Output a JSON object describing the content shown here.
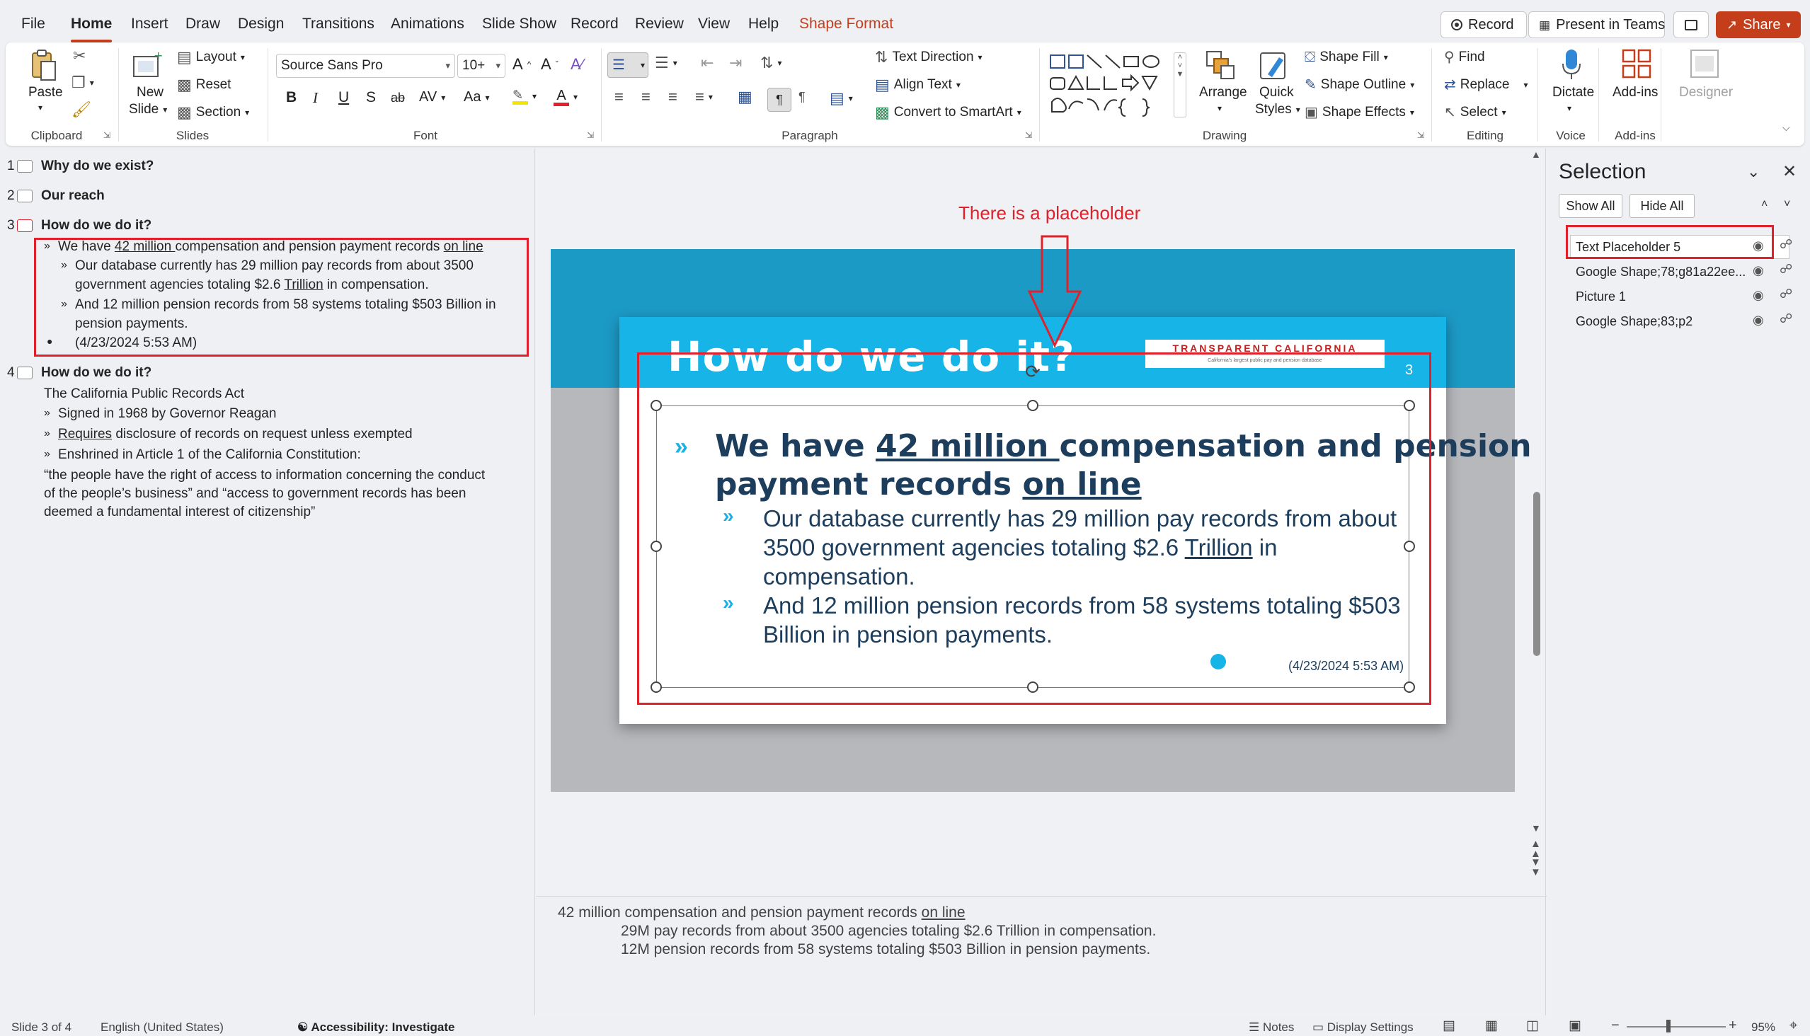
{
  "menu": {
    "items": [
      "File",
      "Home",
      "Insert",
      "Draw",
      "Design",
      "Transitions",
      "Animations",
      "Slide Show",
      "Record",
      "Review",
      "View",
      "Help",
      "Shape Format"
    ],
    "active": "Home",
    "record": "Record",
    "present_teams": "Present in Teams",
    "share": "Share"
  },
  "ribbon": {
    "clipboard": {
      "paste": "Paste",
      "label": "Clipboard"
    },
    "slides": {
      "new_slide_1": "New",
      "new_slide_2": "Slide",
      "layout": "Layout",
      "reset": "Reset",
      "section": "Section",
      "label": "Slides"
    },
    "font": {
      "family": "Source Sans Pro",
      "size": "10+",
      "label": "Font",
      "bold": "B",
      "italic": "I",
      "underline": "U",
      "strike": "S",
      "abc": "ab",
      "spacing": "AV",
      "case": "Aa",
      "grow": "A^",
      "shrink": "A˅"
    },
    "paragraph": {
      "text_direction": "Text Direction",
      "align_text": "Align Text",
      "convert_smartart": "Convert to SmartArt",
      "label": "Paragraph"
    },
    "drawing": {
      "arrange": "Arrange",
      "quick_styles_1": "Quick",
      "quick_styles_2": "Styles",
      "shape_fill": "Shape Fill",
      "shape_outline": "Shape Outline",
      "shape_effects": "Shape Effects",
      "label": "Drawing"
    },
    "editing": {
      "find": "Find",
      "replace": "Replace",
      "select": "Select",
      "label": "Editing"
    },
    "voice": {
      "dictate": "Dictate",
      "label": "Voice"
    },
    "addins": {
      "addins": "Add-ins",
      "label": "Add-ins"
    },
    "designer": {
      "designer": "Designer"
    }
  },
  "outline": {
    "slides": [
      {
        "num": "1",
        "title": "Why do we exist?"
      },
      {
        "num": "2",
        "title": "Our reach"
      },
      {
        "num": "3",
        "title": "How do we do it?"
      },
      {
        "num": "4",
        "title": "How do we do it?"
      }
    ],
    "slide3": {
      "l1_a": "We have ",
      "l1_b": "42 million ",
      "l1_c": "compensation and pension payment records ",
      "l1_d": "on line",
      "l2_a1": "Our database currently has 29 million pay records from about 3500",
      "l2_a2a": "government agencies totaling $2.6 ",
      "l2_a2b": "Trillion",
      "l2_a2c": " in compensation.",
      "l2_b1": "And 12 million pension records from 58 systems totaling $503 Billion in",
      "l2_b2": "pension payments.",
      "date": "(4/23/2024 5:53 AM)"
    },
    "slide4": {
      "intro": "The California Public Records Act",
      "b1": "Signed in 1968 by Governor Reagan",
      "b2a": "Requires",
      "b2b": " disclosure of records on request unless exempted",
      "b3": "Enshrined in Article 1 of the California Constitution:",
      "q1": "“the people have the right of access to information concerning the conduct",
      "q2": "of the people’s business” and “access to government records has been",
      "q3": "deemed a fundamental interest of citizenship”"
    }
  },
  "slide": {
    "title": "How do we do it?",
    "logo": "TRANSPARENT CALIFORNIA",
    "logo_sub": "California's largest public pay and pension database",
    "number": "3",
    "b1_a": "We have ",
    "b1_b": "42 million ",
    "b1_c": "compensation and pension",
    "b1_d": "payment records ",
    "b1_e": "on line",
    "b2_1": "Our database currently has 29 million pay records from about",
    "b2_2a": "3500 government agencies totaling $2.6 ",
    "b2_2b": "Trillion",
    "b2_2c": " in",
    "b2_3": "compensation.",
    "b3_1": "And 12 million pension records from 58 systems totaling $503",
    "b3_2": "Billion in pension payments.",
    "date": "(4/23/2024 5:53 AM)",
    "chevron": "»"
  },
  "annotation": "There is a placeholder",
  "notes": {
    "l1a": "42 million compensation and pension payment records ",
    "l1b": "on line",
    "l2": "29M pay records from about 3500 agencies totaling $2.6 Trillion in compensation.",
    "l3": "12M pension records from 58 systems totaling $503 Billion in pension payments."
  },
  "selection": {
    "title": "Selection",
    "show_all": "Show All",
    "hide_all": "Hide All",
    "items": [
      "Text Placeholder 5",
      "Google Shape;78;g81a22ee...",
      "Picture 1",
      "Google Shape;83;p2"
    ]
  },
  "status": {
    "slide": "Slide 3 of 4",
    "language": "English (United States)",
    "accessibility": "Accessibility: Investigate",
    "notes": "Notes",
    "display": "Display Settings",
    "zoom": "95%"
  },
  "colors": {
    "accent": "#c43e1c",
    "annotation": "#e0202a",
    "slide_blue": "#16b4e7",
    "slide_text": "#1d3d5c"
  }
}
